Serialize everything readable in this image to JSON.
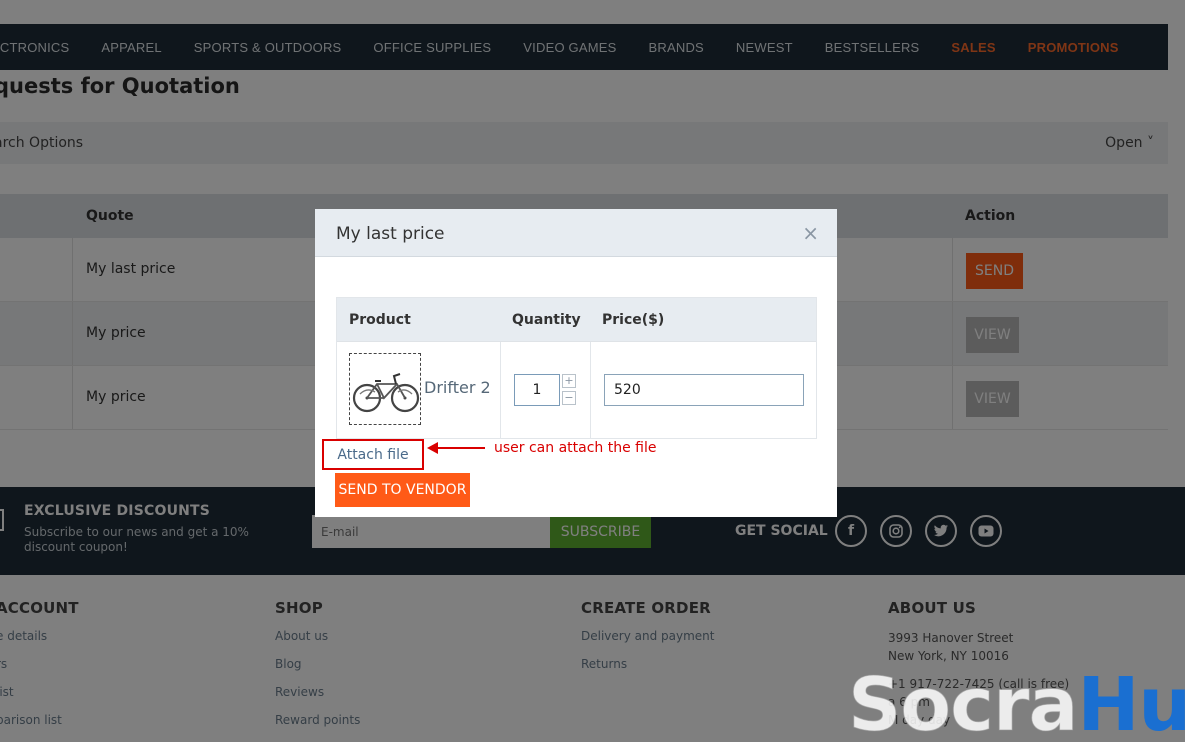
{
  "nav": {
    "items": [
      "ECTRONICS",
      "APPAREL",
      "SPORTS & OUTDOORS",
      "OFFICE SUPPLIES",
      "VIDEO GAMES",
      "BRANDS",
      "NEWEST",
      "BESTSELLERS"
    ],
    "hot_items": [
      "SALES",
      "PROMOTIONS"
    ]
  },
  "page": {
    "title": "quests for Quotation",
    "search_label": "arch Options",
    "search_toggle": "Open ˅"
  },
  "table": {
    "headers": {
      "quote": "Quote",
      "action": "Action"
    },
    "rows": [
      {
        "quote": "My last price",
        "action": "SEND"
      },
      {
        "quote": "My price",
        "action": "VIEW"
      },
      {
        "quote": "My price",
        "action": "VIEW"
      }
    ]
  },
  "footer": {
    "promo_title": "EXCLUSIVE DISCOUNTS",
    "promo_text": "Subscribe to our news and get a 10% discount coupon!",
    "email_placeholder": "E-mail",
    "subscribe": "SUBSCRIBE",
    "social_label": "GET SOCIAL",
    "columns": {
      "account": {
        "title": "ACCOUNT",
        "links": [
          "e details",
          "rs",
          "list",
          "parison list"
        ]
      },
      "shop": {
        "title": "SHOP",
        "links": [
          "About us",
          "Blog",
          "Reviews",
          "Reward points"
        ]
      },
      "order": {
        "title": "CREATE ORDER",
        "links": [
          "Delivery and payment",
          "Returns"
        ]
      },
      "about": {
        "title": "ABOUT US",
        "address1": "3993 Hanover Street",
        "address2": "New York, NY 10016",
        "phone": "+1 917-722-7425 (call is free)",
        "hours": "a      6 pm",
        "days": "M   day     day"
      }
    }
  },
  "modal": {
    "title": "My last price",
    "close": "×",
    "headers": {
      "product": "Product",
      "quantity": "Quantity",
      "price": "Price($)"
    },
    "product_name": "Drifter 2",
    "quantity": "1",
    "price": "520",
    "attach_label": "Attach file",
    "send_label": "SEND TO VENDOR"
  },
  "annotation": {
    "text": "user can attach the file"
  },
  "watermark": {
    "part1": "Socra",
    "part2": "Hub"
  },
  "colors": {
    "accent": "#ff5a17",
    "dark": "#1f2d38",
    "annotation": "#d90000",
    "subscribe": "#5fb031"
  }
}
